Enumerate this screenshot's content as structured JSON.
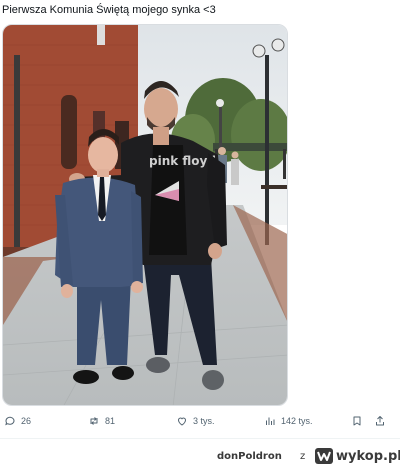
{
  "tweet": {
    "text": "Pierwsza Komunia Świętą mojego synka <3"
  },
  "photo": {
    "shirt_text": "pink floyd"
  },
  "actions": {
    "replies": "26",
    "reposts": "81",
    "likes": "3 tys.",
    "views": "142 tys."
  },
  "footer": {
    "username": "donPoldron",
    "separator": "z",
    "site": "wykop.pl"
  },
  "colors": {
    "icon": "#536471",
    "text": "#0f1419",
    "footer": "#3a3a3a"
  }
}
